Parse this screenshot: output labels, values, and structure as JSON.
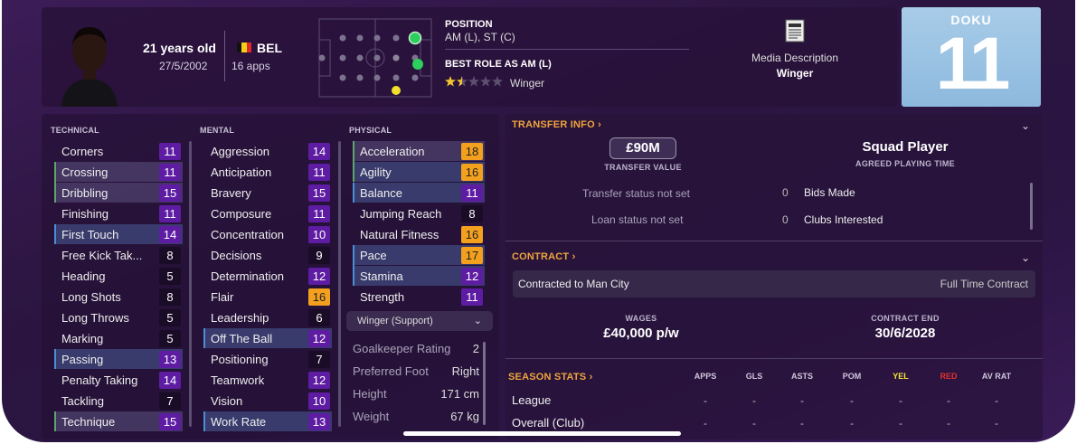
{
  "header": {
    "age": "21 years old",
    "dob": "27/5/2002",
    "nationality": "BEL",
    "apps": "16 apps",
    "position_label": "POSITION",
    "position_value": "AM (L), ST (C)",
    "role_label": "BEST ROLE AS AM (L)",
    "role_stars": 2.5,
    "role_value": "Winger",
    "media_label": "Media Description",
    "media_value": "Winger",
    "shirt_name": "DOKU",
    "shirt_number": "11",
    "flag_colors": [
      "#111111",
      "#f4cf1a",
      "#e02a2a"
    ]
  },
  "attributes": {
    "technical_title": "TECHNICAL",
    "mental_title": "MENTAL",
    "physical_title": "PHYSICAL",
    "technical": [
      {
        "name": "Corners",
        "value": "11"
      },
      {
        "name": "Crossing",
        "value": "11"
      },
      {
        "name": "Dribbling",
        "value": "15"
      },
      {
        "name": "Finishing",
        "value": "11"
      },
      {
        "name": "First Touch",
        "value": "14"
      },
      {
        "name": "Free Kick Tak...",
        "value": "8"
      },
      {
        "name": "Heading",
        "value": "5"
      },
      {
        "name": "Long Shots",
        "value": "8"
      },
      {
        "name": "Long Throws",
        "value": "5"
      },
      {
        "name": "Marking",
        "value": "5"
      },
      {
        "name": "Passing",
        "value": "13"
      },
      {
        "name": "Penalty Taking",
        "value": "14"
      },
      {
        "name": "Tackling",
        "value": "7"
      },
      {
        "name": "Technique",
        "value": "15"
      }
    ],
    "mental": [
      {
        "name": "Aggression",
        "value": "14"
      },
      {
        "name": "Anticipation",
        "value": "11"
      },
      {
        "name": "Bravery",
        "value": "15"
      },
      {
        "name": "Composure",
        "value": "11"
      },
      {
        "name": "Concentration",
        "value": "10"
      },
      {
        "name": "Decisions",
        "value": "9"
      },
      {
        "name": "Determination",
        "value": "12"
      },
      {
        "name": "Flair",
        "value": "16"
      },
      {
        "name": "Leadership",
        "value": "6"
      },
      {
        "name": "Off The Ball",
        "value": "12"
      },
      {
        "name": "Positioning",
        "value": "7"
      },
      {
        "name": "Teamwork",
        "value": "12"
      },
      {
        "name": "Vision",
        "value": "10"
      },
      {
        "name": "Work Rate",
        "value": "13"
      }
    ],
    "physical": [
      {
        "name": "Acceleration",
        "value": "18"
      },
      {
        "name": "Agility",
        "value": "16"
      },
      {
        "name": "Balance",
        "value": "11"
      },
      {
        "name": "Jumping Reach",
        "value": "8"
      },
      {
        "name": "Natural Fitness",
        "value": "16"
      },
      {
        "name": "Pace",
        "value": "17"
      },
      {
        "name": "Stamina",
        "value": "12"
      },
      {
        "name": "Strength",
        "value": "11"
      }
    ],
    "role_select": "Winger (Support)",
    "info": [
      {
        "label": "Goalkeeper Rating",
        "value": "2"
      },
      {
        "label": "Preferred Foot",
        "value": "Right"
      },
      {
        "label": "Height",
        "value": "171 cm"
      },
      {
        "label": "Weight",
        "value": "67 kg"
      }
    ]
  },
  "transfer": {
    "title": "TRANSFER INFO",
    "value": "£90M",
    "value_caption": "TRANSFER VALUE",
    "playing_time": "Squad Player",
    "playing_time_caption": "AGREED PLAYING TIME",
    "transfer_status": "Transfer status not set",
    "loan_status": "Loan status not set",
    "bids_count": "0",
    "bids_label": "Bids Made",
    "clubs_count": "0",
    "clubs_label": "Clubs Interested"
  },
  "contract": {
    "title": "CONTRACT",
    "contracted_to": "Contracted to Man City",
    "type": "Full Time Contract",
    "wages_caption": "WAGES",
    "wages": "£40,000 p/w",
    "end_caption": "CONTRACT END",
    "end": "30/6/2028"
  },
  "season_stats": {
    "title": "SEASON STATS",
    "headers": [
      "APPS",
      "GLS",
      "ASTS",
      "POM",
      "YEL",
      "RED",
      "AV RAT"
    ],
    "rows": [
      {
        "label": "League",
        "cells": [
          "-",
          "-",
          "-",
          "-",
          "-",
          "-",
          "-"
        ]
      },
      {
        "label": "Overall (Club)",
        "cells": [
          "-",
          "-",
          "-",
          "-",
          "-",
          "-",
          "-"
        ]
      }
    ]
  }
}
